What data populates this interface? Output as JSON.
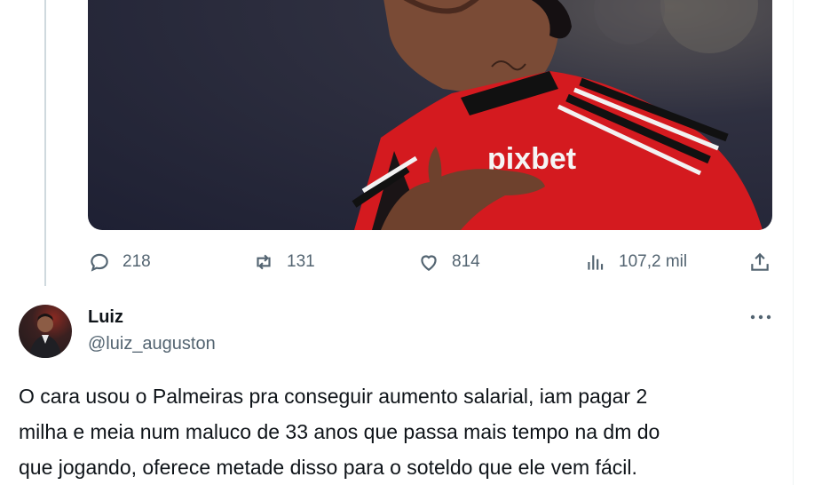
{
  "previous_tweet": {
    "media": {
      "description_icon": "photo",
      "jersey_brand_text": "pixbet"
    },
    "actions": {
      "replies": "218",
      "retweets": "131",
      "likes": "814",
      "views": "107,2 mil"
    }
  },
  "reply_tweet": {
    "display_name": "Luiz",
    "handle": "@luiz_auguston",
    "text": "O cara usou o Palmeiras pra conseguir aumento salarial, iam pagar 2\nmilha e meia num maluco de 33 anos que passa mais tempo na dm do\nque jogando, oferece metade disso para o soteldo que ele vem fácil."
  },
  "colors": {
    "text_primary": "#0f1419",
    "text_secondary": "#536471",
    "thread_line": "#cfd9de",
    "border": "#eff3f4"
  }
}
